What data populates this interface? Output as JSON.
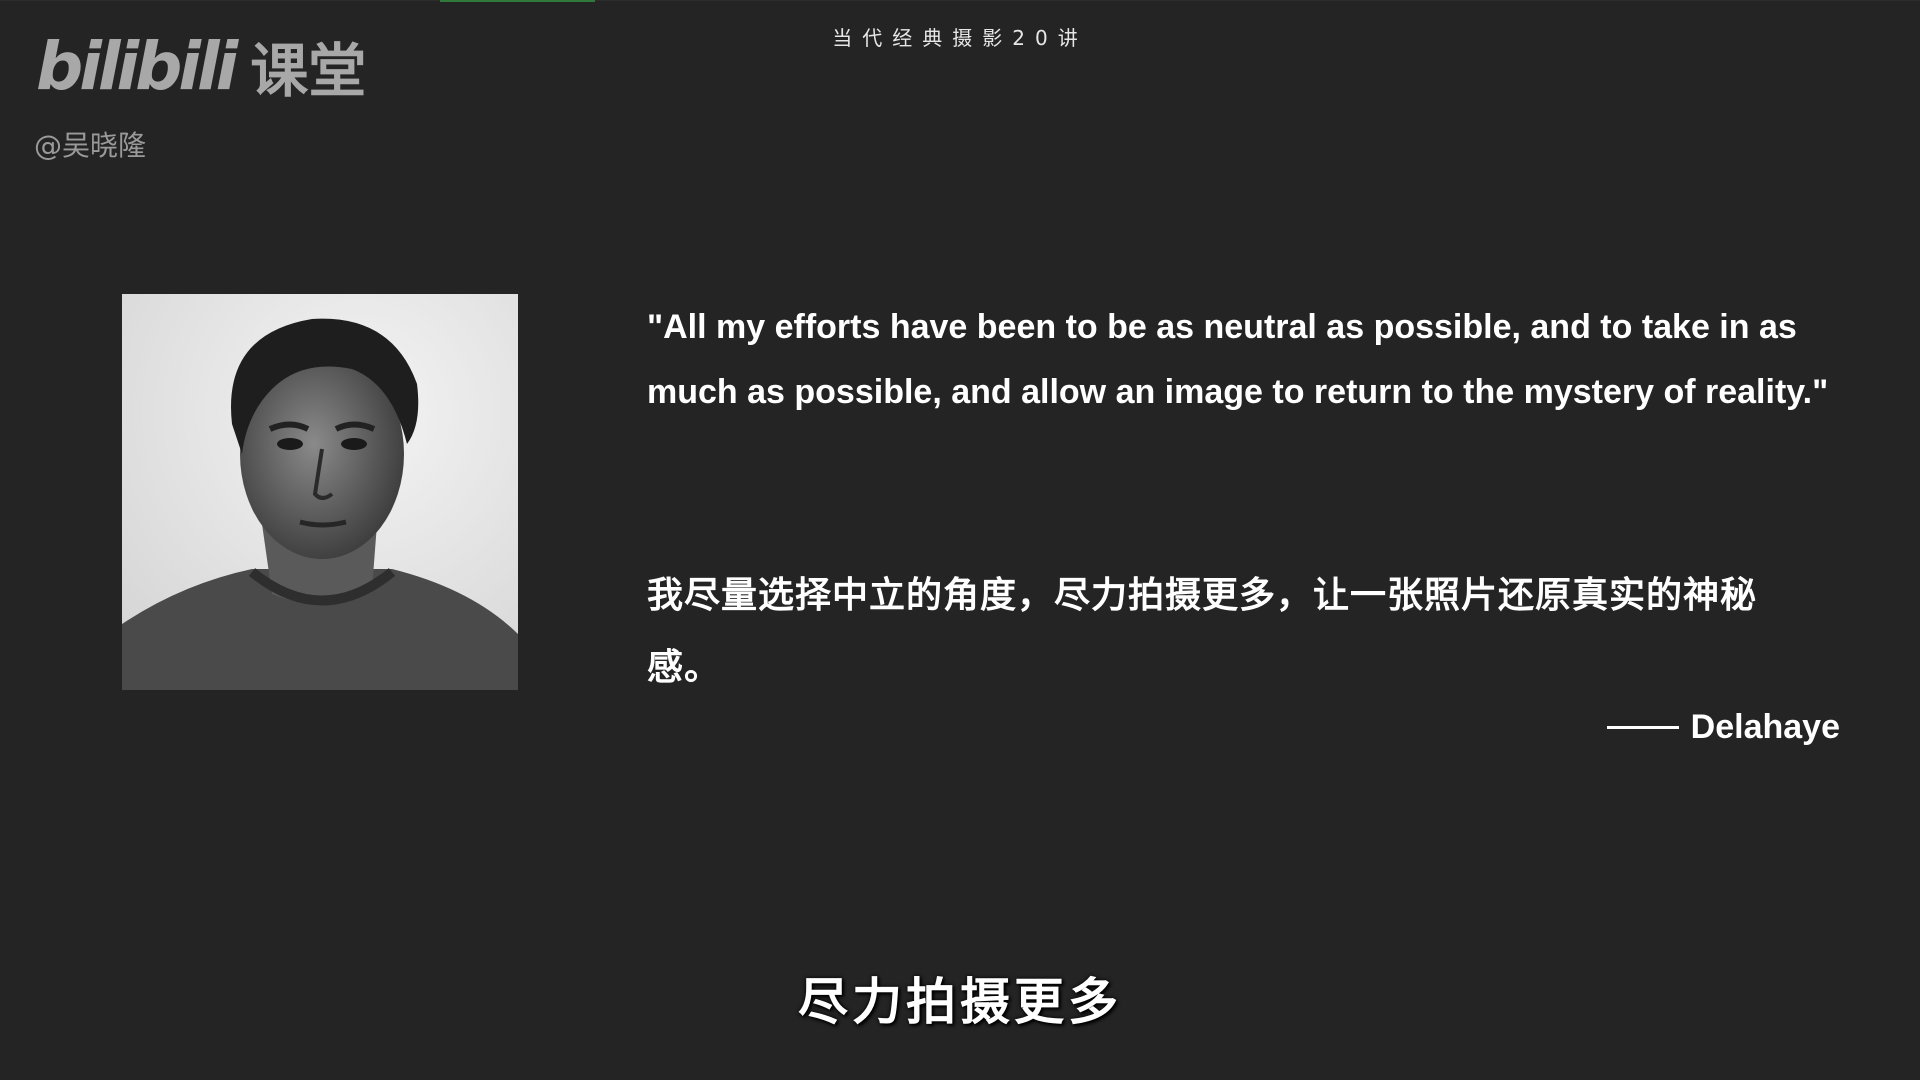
{
  "header": {
    "course_title": "当代经典摄影20讲"
  },
  "logo": {
    "wordmark": "bilibili",
    "suffix": "课堂",
    "author_handle": "@吴晓隆"
  },
  "quote": {
    "english": "\"All my efforts have been to be as neutral as possible, and to take in as much as possible, and allow an image to return to the mystery of reality.\"",
    "chinese": "我尽量选择中立的角度，尽力拍摄更多，让一张照片还原真实的神秘感。",
    "author": "Delahaye"
  },
  "subtitle": {
    "text": "尽力拍摄更多"
  },
  "colors": {
    "background": "#242424",
    "text": "#ffffff",
    "logo": "#a8a8a8",
    "accent": "#2f7a3a"
  }
}
